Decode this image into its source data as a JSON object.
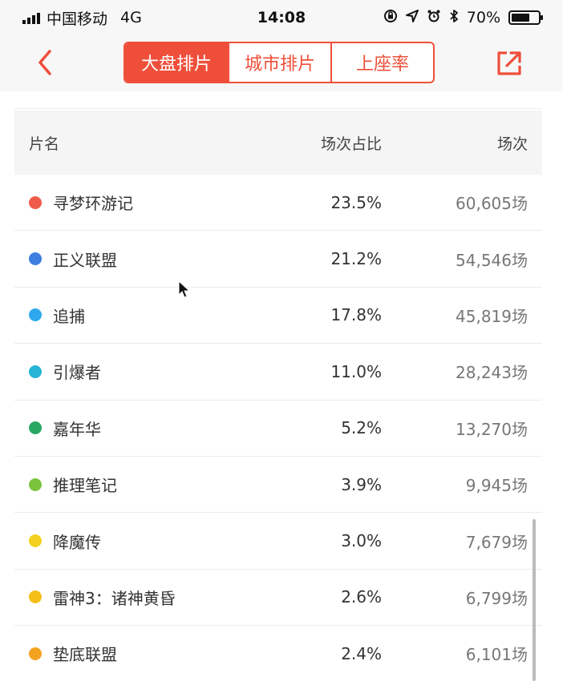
{
  "status_bar": {
    "carrier": "中国移动",
    "network": "4G",
    "time": "14:08",
    "battery": "70%",
    "battery_level": 0.7
  },
  "nav": {
    "tabs": [
      {
        "label": "大盘排片",
        "active": true
      },
      {
        "label": "城市排片",
        "active": false
      },
      {
        "label": "上座率",
        "active": false
      }
    ],
    "accent_color": "#ef4f3a"
  },
  "table": {
    "headers": {
      "name": "片名",
      "ratio": "场次占比",
      "count": "场次"
    },
    "rows": [
      {
        "name": "寻梦环游记",
        "ratio": "23.5%",
        "count": "60,605场",
        "color": "#ef5a4a"
      },
      {
        "name": "正义联盟",
        "ratio": "21.2%",
        "count": "54,546场",
        "color": "#3d7fe0"
      },
      {
        "name": "追捕",
        "ratio": "17.8%",
        "count": "45,819场",
        "color": "#2ea8ee"
      },
      {
        "name": "引爆者",
        "ratio": "11.0%",
        "count": "28,243场",
        "color": "#25b4d6"
      },
      {
        "name": "嘉年华",
        "ratio": "5.2%",
        "count": "13,270场",
        "color": "#27a862"
      },
      {
        "name": "推理笔记",
        "ratio": "3.9%",
        "count": "9,945场",
        "color": "#7cc33c"
      },
      {
        "name": "降魔传",
        "ratio": "3.0%",
        "count": "7,679场",
        "color": "#f2d21f"
      },
      {
        "name": "雷神3：诸神黄昏",
        "ratio": "2.6%",
        "count": "6,799场",
        "color": "#f5bf18"
      },
      {
        "name": "垫底联盟",
        "ratio": "2.4%",
        "count": "6,101场",
        "color": "#f4a321"
      }
    ]
  }
}
